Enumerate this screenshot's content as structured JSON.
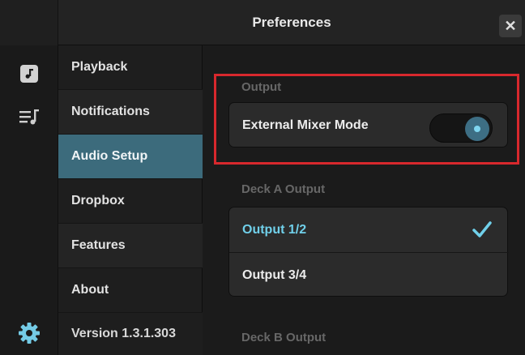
{
  "window": {
    "title": "Preferences",
    "close_label": "✕"
  },
  "rail": {
    "icons": [
      "music-note-icon",
      "playlist-icon",
      "gear-icon"
    ]
  },
  "nav": {
    "items": [
      {
        "label": "Playback"
      },
      {
        "label": "Notifications"
      },
      {
        "label": "Audio Setup"
      },
      {
        "label": "Dropbox"
      },
      {
        "label": "Features"
      },
      {
        "label": "About"
      }
    ],
    "version": "Version 1.3.1.303",
    "active_index": 2
  },
  "content": {
    "output_section": {
      "label": "Output",
      "row_label": "External Mixer Mode",
      "toggle_on": true
    },
    "deck_a": {
      "label": "Deck A Output",
      "options": [
        "Output 1/2",
        "Output 3/4"
      ],
      "selected_index": 0
    },
    "deck_b": {
      "label": "Deck B Output"
    }
  },
  "colors": {
    "accent": "#3c6b7c",
    "selected_text": "#70d0ea",
    "highlight_box": "#d8282d"
  }
}
